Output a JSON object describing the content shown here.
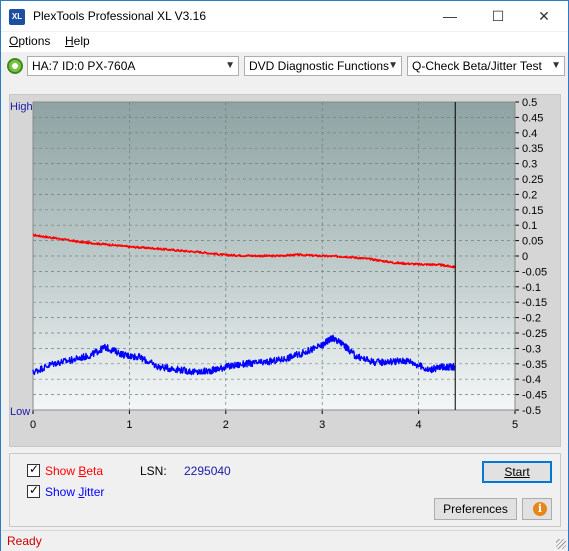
{
  "app": {
    "title": "PlexTools Professional XL V3.16",
    "icon_text": "XL",
    "window_controls": {
      "minimize": "—",
      "maximize": "☐",
      "close": "✕"
    }
  },
  "menu": {
    "options": {
      "accel": "O",
      "rest": "ptions"
    },
    "help": {
      "accel": "H",
      "rest": "elp"
    }
  },
  "toolbar": {
    "drive": "HA:7 ID:0  PX-760A",
    "function": "DVD Diagnostic Functions",
    "test": "Q-Check Beta/Jitter Test",
    "arrow": "▼"
  },
  "chart_data": {
    "type": "line",
    "xlim": [
      0,
      5
    ],
    "x_ticks": [
      "0",
      "1",
      "2",
      "3",
      "4",
      "5"
    ],
    "y_right_lim": [
      -0.5,
      0.5
    ],
    "y_right_ticks": [
      "0.5",
      "0.45",
      "0.4",
      "0.35",
      "0.3",
      "0.25",
      "0.2",
      "0.15",
      "0.1",
      "0.05",
      "0",
      "-0.05",
      "-0.1",
      "-0.15",
      "-0.2",
      "-0.25",
      "-0.3",
      "-0.35",
      "-0.4",
      "-0.45",
      "-0.5"
    ],
    "y_left_top_label": "High",
    "y_left_bottom_label": "Low",
    "progress_marker_x": 4.38,
    "grid": true,
    "series": [
      {
        "color": "#ff0000",
        "x": [
          0,
          0.25,
          0.5,
          0.75,
          1.0,
          1.25,
          1.5,
          1.75,
          2.0,
          2.25,
          2.5,
          2.75,
          3.0,
          3.25,
          3.5,
          3.75,
          4.0,
          4.2,
          4.38
        ],
        "y": [
          0.068,
          0.057,
          0.045,
          0.038,
          0.03,
          0.025,
          0.018,
          0.012,
          0.003,
          0.001,
          0.0,
          0.004,
          0.0,
          -0.002,
          -0.01,
          -0.022,
          -0.027,
          -0.028,
          -0.036
        ]
      },
      {
        "color": "#0000ff",
        "x": [
          0,
          0.2,
          0.4,
          0.6,
          0.75,
          0.95,
          1.1,
          1.3,
          1.5,
          1.7,
          1.85,
          2.0,
          2.2,
          2.4,
          2.6,
          2.8,
          3.0,
          3.1,
          3.2,
          3.35,
          3.55,
          3.75,
          3.9,
          4.1,
          4.25,
          4.38
        ],
        "y": [
          -0.378,
          -0.35,
          -0.338,
          -0.322,
          -0.296,
          -0.322,
          -0.328,
          -0.36,
          -0.368,
          -0.378,
          -0.372,
          -0.36,
          -0.35,
          -0.346,
          -0.335,
          -0.315,
          -0.29,
          -0.265,
          -0.283,
          -0.326,
          -0.345,
          -0.342,
          -0.34,
          -0.37,
          -0.36,
          -0.36
        ]
      }
    ]
  },
  "options": {
    "show_beta": {
      "pre": "Show ",
      "accel": "B",
      "post": "eta",
      "color": "#ff0000"
    },
    "show_jitter": {
      "pre": "Show ",
      "accel": "J",
      "post": "itter",
      "color": "#0000ff"
    }
  },
  "lsn": {
    "label": "LSN:",
    "value": "2295040"
  },
  "buttons": {
    "start": "Start",
    "preferences": "Preferences",
    "info_glyph": "i"
  },
  "status": {
    "text": "Ready"
  }
}
